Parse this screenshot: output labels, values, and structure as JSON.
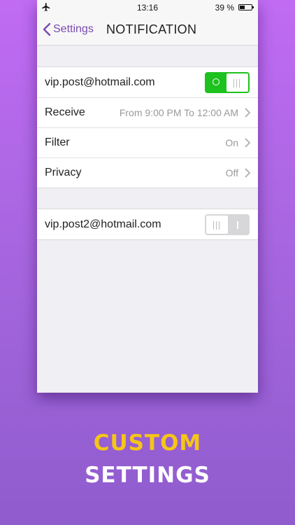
{
  "status_bar": {
    "time": "13:16",
    "battery_percent": "39 %",
    "battery_level": 0.39
  },
  "nav": {
    "back_label": "Settings",
    "title": "NOTIFICATION"
  },
  "group1": {
    "account": "vip.post@hotmail.com",
    "account_enabled": true,
    "rows": [
      {
        "label": "Receive",
        "value": "From 9:00 PM To 12:00 AM"
      },
      {
        "label": "Filter",
        "value": "On"
      },
      {
        "label": "Privacy",
        "value": "Off"
      }
    ]
  },
  "group2": {
    "account": "vip.post2@hotmail.com",
    "account_enabled": false
  },
  "caption": {
    "line1": "CUSTOM",
    "line2": "SETTINGS"
  },
  "colors": {
    "background_top": "#c06bf3",
    "background_bottom": "#8f5ccd",
    "accent": "#7a4bb0",
    "toggle_on": "#1ec21e",
    "caption_yellow": "#f5c518"
  }
}
